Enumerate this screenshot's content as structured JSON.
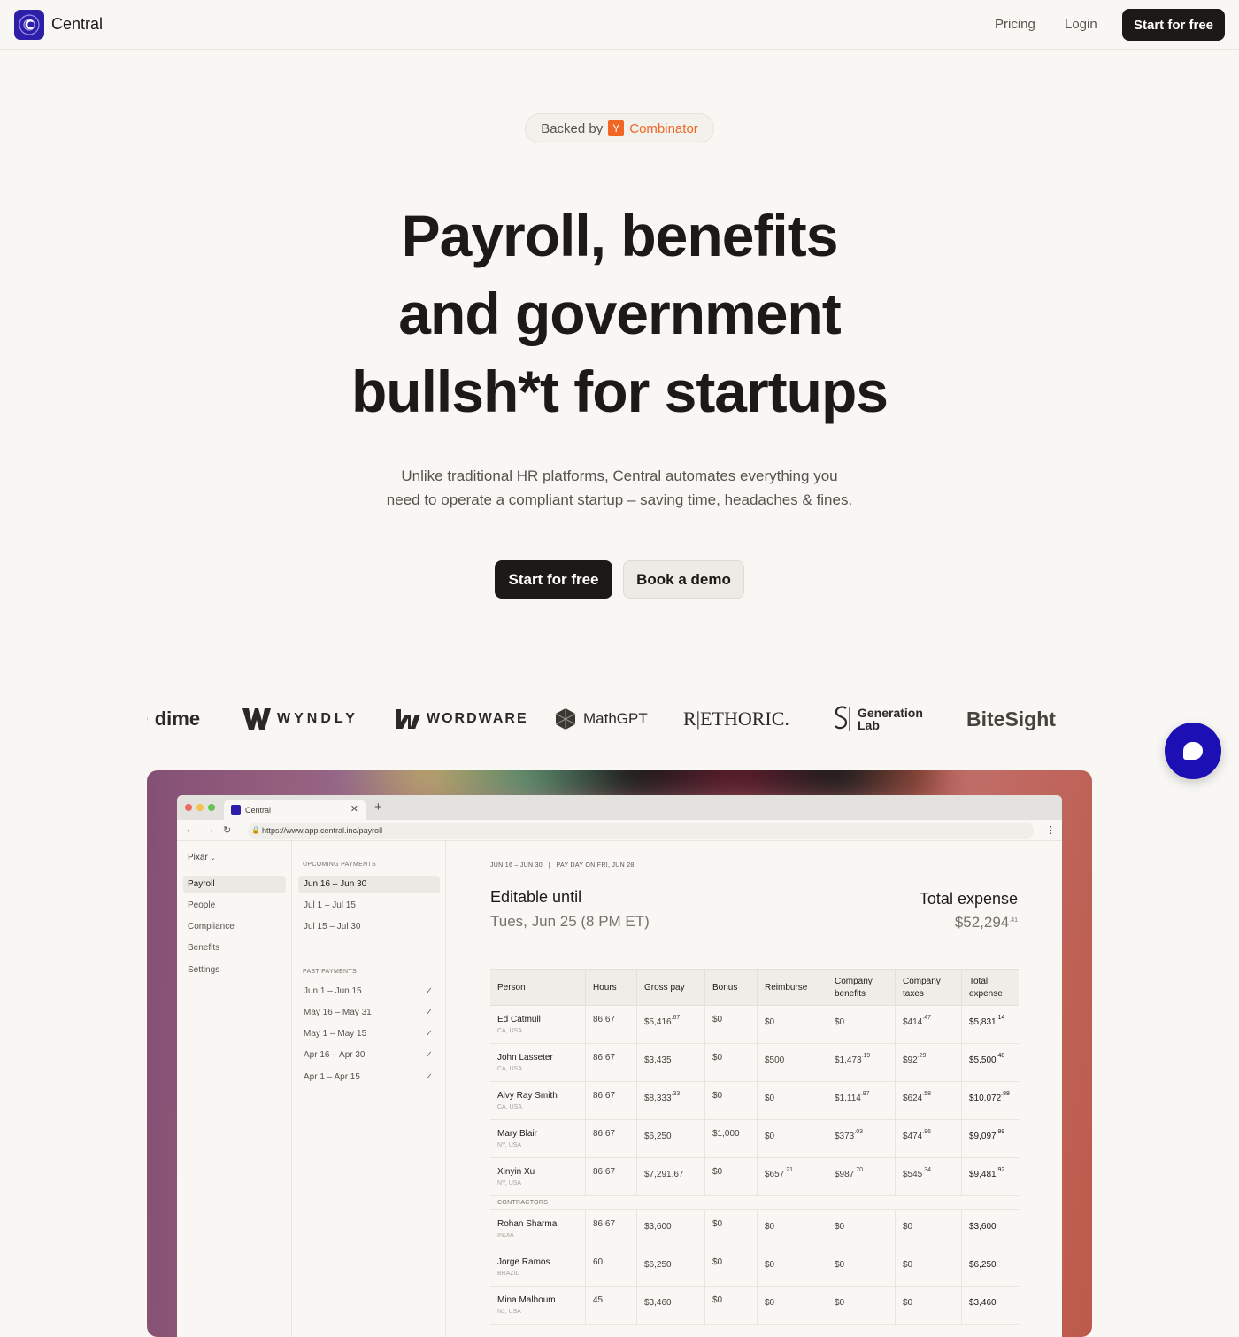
{
  "nav": {
    "logo_text": "Central",
    "logo_letter": "C",
    "pricing": "Pricing",
    "login": "Login",
    "cta": "Start for free"
  },
  "badge": {
    "prefix": "Backed by",
    "yc_letter": "Y",
    "yc_word": "Combinator"
  },
  "hero": {
    "line1": "Payroll, benefits",
    "line2": "and government",
    "line3": "bullsh*t for startups",
    "sub1": "Unlike traditional HR platforms, Central automates everything you",
    "sub2": "need to operate a compliant startup – saving time, headaches & fines.",
    "primary_cta": "Start for free",
    "secondary_cta": "Book a demo"
  },
  "logos": {
    "dime": "dime",
    "wyndly": "WYNDLY",
    "wordware": "WORDWARE",
    "mathgpt": "MathGPT",
    "rethoric": "R|ETHORIC.",
    "genlab_1": "Generation",
    "genlab_2": "Lab",
    "bitesight": "BiteSight"
  },
  "browser": {
    "tab_title": "Central",
    "url": "https://www.app.central.inc/payroll",
    "org": "Pixar",
    "sidebar": [
      "Payroll",
      "People",
      "Compliance",
      "Benefits",
      "Settings"
    ],
    "upcoming_label": "UPCOMING PAYMENTS",
    "upcoming": [
      "Jun 16 – Jun 30",
      "Jul 1 – Jul 15",
      "Jul 15 – Jul 30"
    ],
    "past_label": "PAST PAYMENTS",
    "past": [
      "Jun 1 – Jun 15",
      "May 16 – May 31",
      "May 1 – May 15",
      "Apr 16 – Apr 30",
      "Apr 1 – Apr 15"
    ],
    "period_header": "JUN 16 – JUN 30   |   PAY DAY ON FRI, JUN 28",
    "editable_title": "Editable until",
    "editable_date": "Tues, Jun 25 (8 PM ET)",
    "total_title": "Total expense",
    "total_main": "$52,294",
    "total_cents": ".41",
    "columns": [
      "Person",
      "Hours",
      "Gross pay",
      "Bonus",
      "Reimburse",
      "Company benefits",
      "Company taxes",
      "Total expense"
    ],
    "employees": [
      {
        "name": "Ed Catmull",
        "loc": "CA, USA",
        "hours": "86.67",
        "gross": "$5,416",
        "gross_c": ".67",
        "bonus": "$0",
        "reimb": "$0",
        "reimb_c": "",
        "benefits": "$0",
        "benefits_c": "",
        "taxes": "$414",
        "taxes_c": ".47",
        "total": "$5,831",
        "total_c": ".14"
      },
      {
        "name": "John Lasseter",
        "loc": "CA, USA",
        "hours": "86.67",
        "gross": "$3,435",
        "gross_c": "",
        "bonus": "$0",
        "reimb": "$500",
        "reimb_c": "",
        "benefits": "$1,473",
        "benefits_c": ".19",
        "taxes": "$92",
        "taxes_c": ".29",
        "total": "$5,500",
        "total_c": ".48"
      },
      {
        "name": "Alvy Ray Smith",
        "loc": "CA, USA",
        "hours": "86.67",
        "gross": "$8,333",
        "gross_c": ".33",
        "bonus": "$0",
        "reimb": "$0",
        "reimb_c": "",
        "benefits": "$1,114",
        "benefits_c": ".97",
        "taxes": "$624",
        "taxes_c": ".58",
        "total": "$10,072",
        "total_c": ".88"
      },
      {
        "name": "Mary Blair",
        "loc": "NY, USA",
        "hours": "86.67",
        "gross": "$6,250",
        "gross_c": "",
        "bonus": "$1,000",
        "reimb": "$0",
        "reimb_c": "",
        "benefits": "$373",
        "benefits_c": ".03",
        "taxes": "$474",
        "taxes_c": ".96",
        "total": "$9,097",
        "total_c": ".99"
      },
      {
        "name": "Xinyin Xu",
        "loc": "NY, USA",
        "hours": "86.67",
        "gross": "$7,291.67",
        "gross_c": "",
        "bonus": "$0",
        "reimb": "$657",
        "reimb_c": ".21",
        "benefits": "$987",
        "benefits_c": ".70",
        "taxes": "$545",
        "taxes_c": ".34",
        "total": "$9,481",
        "total_c": ".92"
      }
    ],
    "contractors_label": "CONTRACTORS",
    "contractors": [
      {
        "name": "Rohan Sharma",
        "loc": "INDIA",
        "hours": "86.67",
        "gross": "$3,600",
        "gross_c": "",
        "bonus": "$0",
        "reimb": "$0",
        "reimb_c": "",
        "benefits": "$0",
        "benefits_c": "",
        "taxes": "$0",
        "taxes_c": "",
        "total": "$3,600",
        "total_c": ""
      },
      {
        "name": "Jorge Ramos",
        "loc": "BRAZIL",
        "hours": "60",
        "gross": "$6,250",
        "gross_c": "",
        "bonus": "$0",
        "reimb": "$0",
        "reimb_c": "",
        "benefits": "$0",
        "benefits_c": "",
        "taxes": "$0",
        "taxes_c": "",
        "total": "$6,250",
        "total_c": ""
      },
      {
        "name": "Mina Malhoum",
        "loc": "NJ, USA",
        "hours": "45",
        "gross": "$3,460",
        "gross_c": "",
        "bonus": "$0",
        "reimb": "$0",
        "reimb_c": "",
        "benefits": "$0",
        "benefits_c": "",
        "taxes": "$0",
        "taxes_c": "",
        "total": "$3,460",
        "total_c": ""
      }
    ]
  },
  "colors": {
    "brand": "#2e1fa8",
    "ink": "#1c1917",
    "yc_orange": "#f26625",
    "chat": "#1c10b5"
  }
}
